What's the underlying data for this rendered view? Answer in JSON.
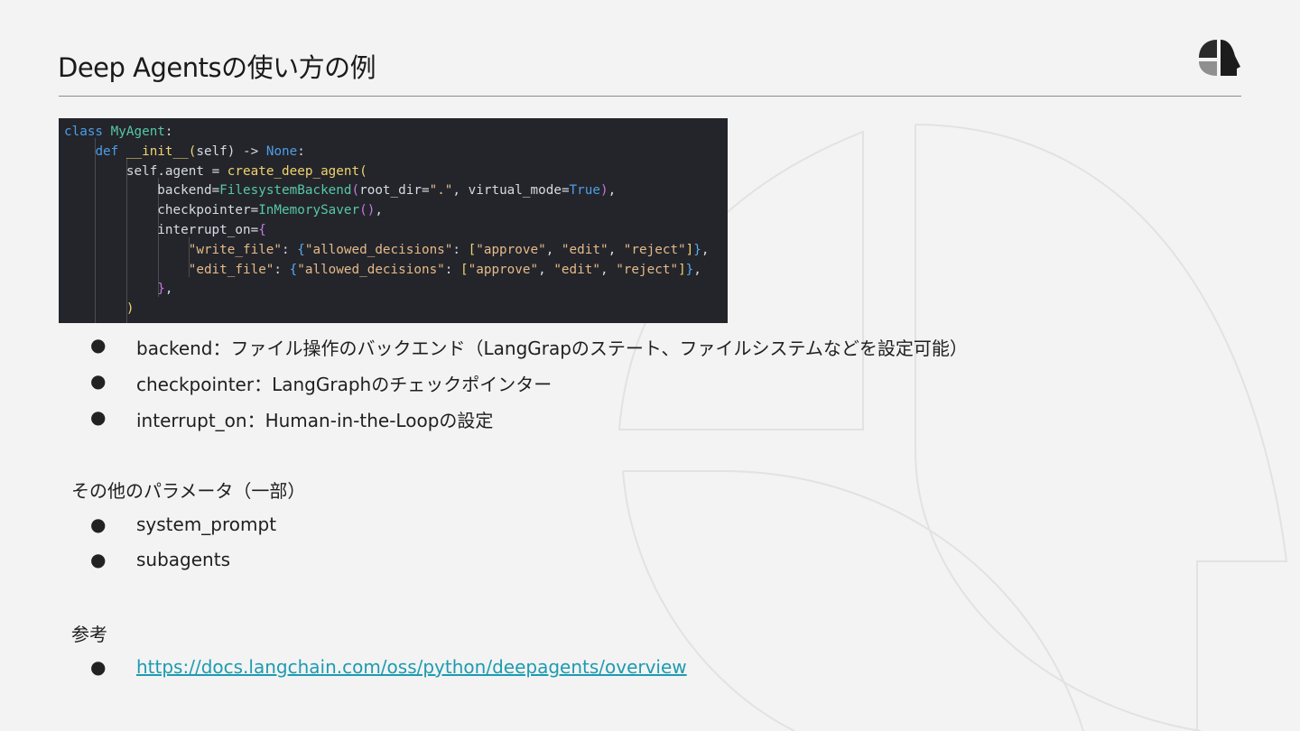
{
  "slide": {
    "title": "Deep Agentsの使い方の例"
  },
  "code": {
    "lines": [
      [
        [
          "class ",
          "kw"
        ],
        [
          "MyAgent",
          "cls"
        ],
        [
          ":",
          "txt"
        ]
      ],
      [
        [
          "    ",
          "txt"
        ],
        [
          "def ",
          "kw"
        ],
        [
          "__init__",
          "fn"
        ],
        [
          "(",
          "punc"
        ],
        [
          "self",
          "txt"
        ],
        [
          ") -> ",
          "txt"
        ],
        [
          "None",
          "kw"
        ],
        [
          ":",
          "txt"
        ]
      ],
      [
        [
          "        ",
          "txt"
        ],
        [
          "self",
          "txt"
        ],
        [
          ".agent = ",
          "txt"
        ],
        [
          "create_deep_agent",
          "fn"
        ],
        [
          "(",
          "punc"
        ]
      ],
      [
        [
          "            ",
          "txt"
        ],
        [
          "backend",
          "txt"
        ],
        [
          "=",
          "txt"
        ],
        [
          "FilesystemBackend",
          "cls"
        ],
        [
          "(",
          "pur"
        ],
        [
          "root_dir",
          "txt"
        ],
        [
          "=",
          "txt"
        ],
        [
          "\".\"",
          "str"
        ],
        [
          ", ",
          "txt"
        ],
        [
          "virtual_mode",
          "txt"
        ],
        [
          "=",
          "txt"
        ],
        [
          "True",
          "kw"
        ],
        [
          ")",
          "pur"
        ],
        [
          ",",
          "txt"
        ]
      ],
      [
        [
          "            ",
          "txt"
        ],
        [
          "checkpointer",
          "txt"
        ],
        [
          "=",
          "txt"
        ],
        [
          "InMemorySaver",
          "cls"
        ],
        [
          "()",
          "pur"
        ],
        [
          ",",
          "txt"
        ]
      ],
      [
        [
          "            ",
          "txt"
        ],
        [
          "interrupt_on",
          "txt"
        ],
        [
          "=",
          "txt"
        ],
        [
          "{",
          "pur"
        ]
      ],
      [
        [
          "                ",
          "txt"
        ],
        [
          "\"write_file\"",
          "str"
        ],
        [
          ": ",
          "txt"
        ],
        [
          "{",
          "blu"
        ],
        [
          "\"allowed_decisions\"",
          "str"
        ],
        [
          ": ",
          "txt"
        ],
        [
          "[",
          "punc"
        ],
        [
          "\"approve\"",
          "str"
        ],
        [
          ", ",
          "txt"
        ],
        [
          "\"edit\"",
          "str"
        ],
        [
          ", ",
          "txt"
        ],
        [
          "\"reject\"",
          "str"
        ],
        [
          "]",
          "punc"
        ],
        [
          "}",
          "blu"
        ],
        [
          ",",
          "txt"
        ]
      ],
      [
        [
          "                ",
          "txt"
        ],
        [
          "\"edit_file\"",
          "str"
        ],
        [
          ": ",
          "txt"
        ],
        [
          "{",
          "blu"
        ],
        [
          "\"allowed_decisions\"",
          "str"
        ],
        [
          ": ",
          "txt"
        ],
        [
          "[",
          "punc"
        ],
        [
          "\"approve\"",
          "str"
        ],
        [
          ", ",
          "txt"
        ],
        [
          "\"edit\"",
          "str"
        ],
        [
          ", ",
          "txt"
        ],
        [
          "\"reject\"",
          "str"
        ],
        [
          "]",
          "punc"
        ],
        [
          "}",
          "blu"
        ],
        [
          ",",
          "txt"
        ]
      ],
      [
        [
          "            ",
          "txt"
        ],
        [
          "}",
          "pur"
        ],
        [
          ",",
          "txt"
        ]
      ],
      [
        [
          "        ",
          "txt"
        ],
        [
          ")",
          "punc"
        ]
      ]
    ]
  },
  "bullets_main": [
    "backend：ファイル操作のバックエンド（LangGrapのステート、ファイルシステムなどを設定可能）",
    "checkpointer：LangGraphのチェックポインター",
    "interrupt_on：Human-in-the-Loopの設定"
  ],
  "params": {
    "heading": "その他のパラメータ（一部）",
    "items": [
      "system_prompt",
      "subagents"
    ]
  },
  "references": {
    "heading": "参考",
    "link": "https://docs.langchain.com/oss/python/deepagents/overview"
  },
  "bullet_symbol": "●",
  "colors": {
    "background": "#f3f3f3",
    "code_background": "#23252b",
    "link": "#1d9bb0"
  }
}
